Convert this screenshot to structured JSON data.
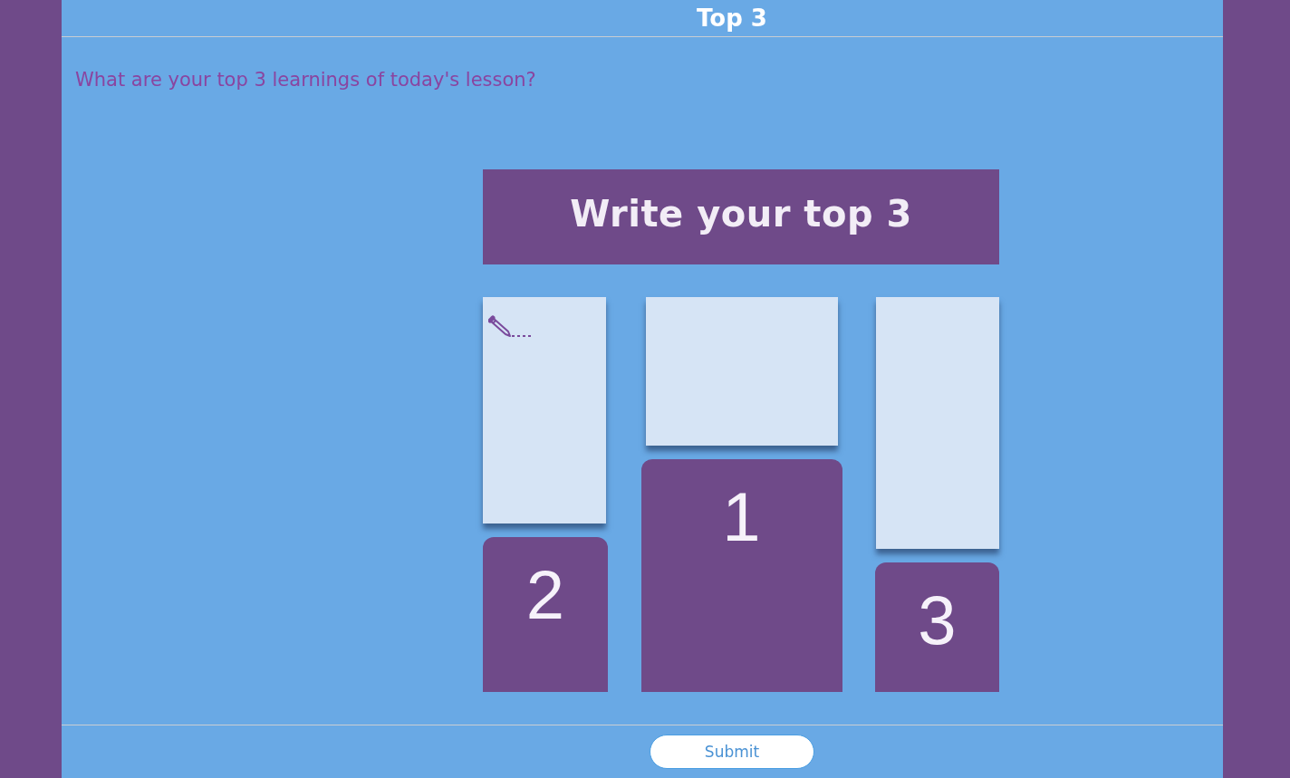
{
  "header": {
    "title": "Top 3"
  },
  "question": {
    "text": "What are your top 3 learnings of today's lesson?"
  },
  "board": {
    "title": "Write your top 3",
    "places": [
      {
        "rank": "2",
        "active": true
      },
      {
        "rank": "1",
        "active": false
      },
      {
        "rank": "3",
        "active": false
      }
    ]
  },
  "submit_button": {
    "label": "Submit"
  }
}
